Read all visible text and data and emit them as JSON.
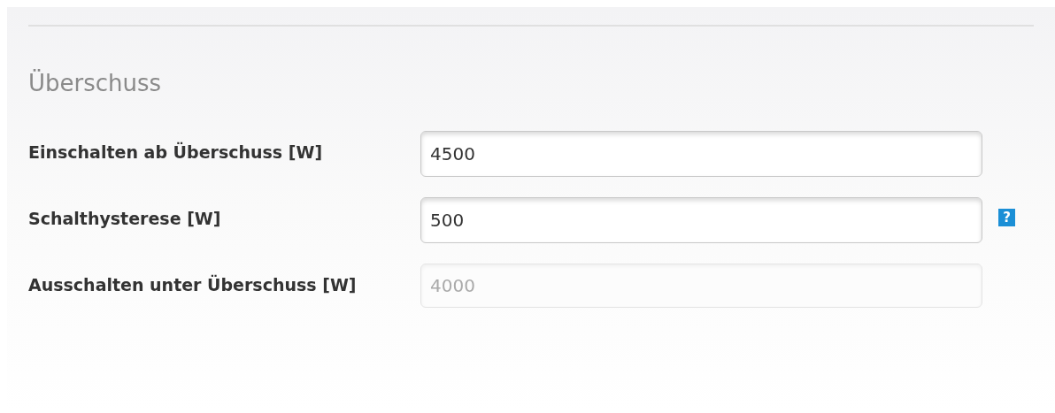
{
  "section": {
    "title": "Überschuss"
  },
  "fields": [
    {
      "label": "Einschalten ab Überschuss [W]",
      "value": "4500",
      "disabled": false
    },
    {
      "label": "Schalthysterese [W]",
      "value": "500",
      "disabled": false,
      "help": "?"
    },
    {
      "label": "Ausschalten unter Überschuss [W]",
      "value": "4000",
      "disabled": true
    }
  ]
}
